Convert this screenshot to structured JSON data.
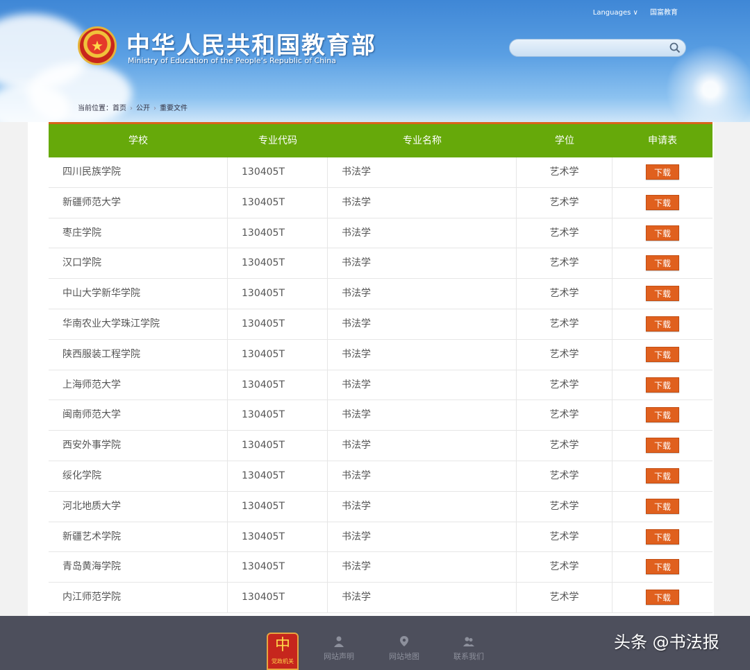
{
  "header": {
    "site_title": "中华人民共和国教育部",
    "site_subtitle": "Ministry of Education of the People's Republic of China",
    "languages_label": "Languages ∨",
    "accessibility_label": "国富教育",
    "search": {
      "placeholder": ""
    }
  },
  "breadcrumb": {
    "prefix": "当前位置：",
    "items": [
      "首页",
      "公开",
      "重要文件"
    ]
  },
  "table": {
    "headers": [
      "学校",
      "专业代码",
      "专业名称",
      "学位",
      "申请表"
    ],
    "download_label": "下载",
    "rows": [
      [
        "四川民族学院",
        "130405T",
        "书法学",
        "艺术学"
      ],
      [
        "新疆师范大学",
        "130405T",
        "书法学",
        "艺术学"
      ],
      [
        "枣庄学院",
        "130405T",
        "书法学",
        "艺术学"
      ],
      [
        "汉口学院",
        "130405T",
        "书法学",
        "艺术学"
      ],
      [
        "中山大学新华学院",
        "130405T",
        "书法学",
        "艺术学"
      ],
      [
        "华南农业大学珠江学院",
        "130405T",
        "书法学",
        "艺术学"
      ],
      [
        "陕西服装工程学院",
        "130405T",
        "书法学",
        "艺术学"
      ],
      [
        "上海师范大学",
        "130405T",
        "书法学",
        "艺术学"
      ],
      [
        "闽南师范大学",
        "130405T",
        "书法学",
        "艺术学"
      ],
      [
        "西安外事学院",
        "130405T",
        "书法学",
        "艺术学"
      ],
      [
        "绥化学院",
        "130405T",
        "书法学",
        "艺术学"
      ],
      [
        "河北地质大学",
        "130405T",
        "书法学",
        "艺术学"
      ],
      [
        "新疆艺术学院",
        "130405T",
        "书法学",
        "艺术学"
      ],
      [
        "青岛黄海学院",
        "130405T",
        "书法学",
        "艺术学"
      ],
      [
        "内江师范学院",
        "130405T",
        "书法学",
        "艺术学"
      ]
    ]
  },
  "footer": {
    "logo_caption": "党政机关",
    "links": [
      "网站声明",
      "网站地图",
      "联系我们"
    ]
  },
  "watermark": "头条 @书法报",
  "colors": {
    "header_green": "#66a90a",
    "download_orange": "#e0601e",
    "footer_bg": "#4d4f5c"
  }
}
